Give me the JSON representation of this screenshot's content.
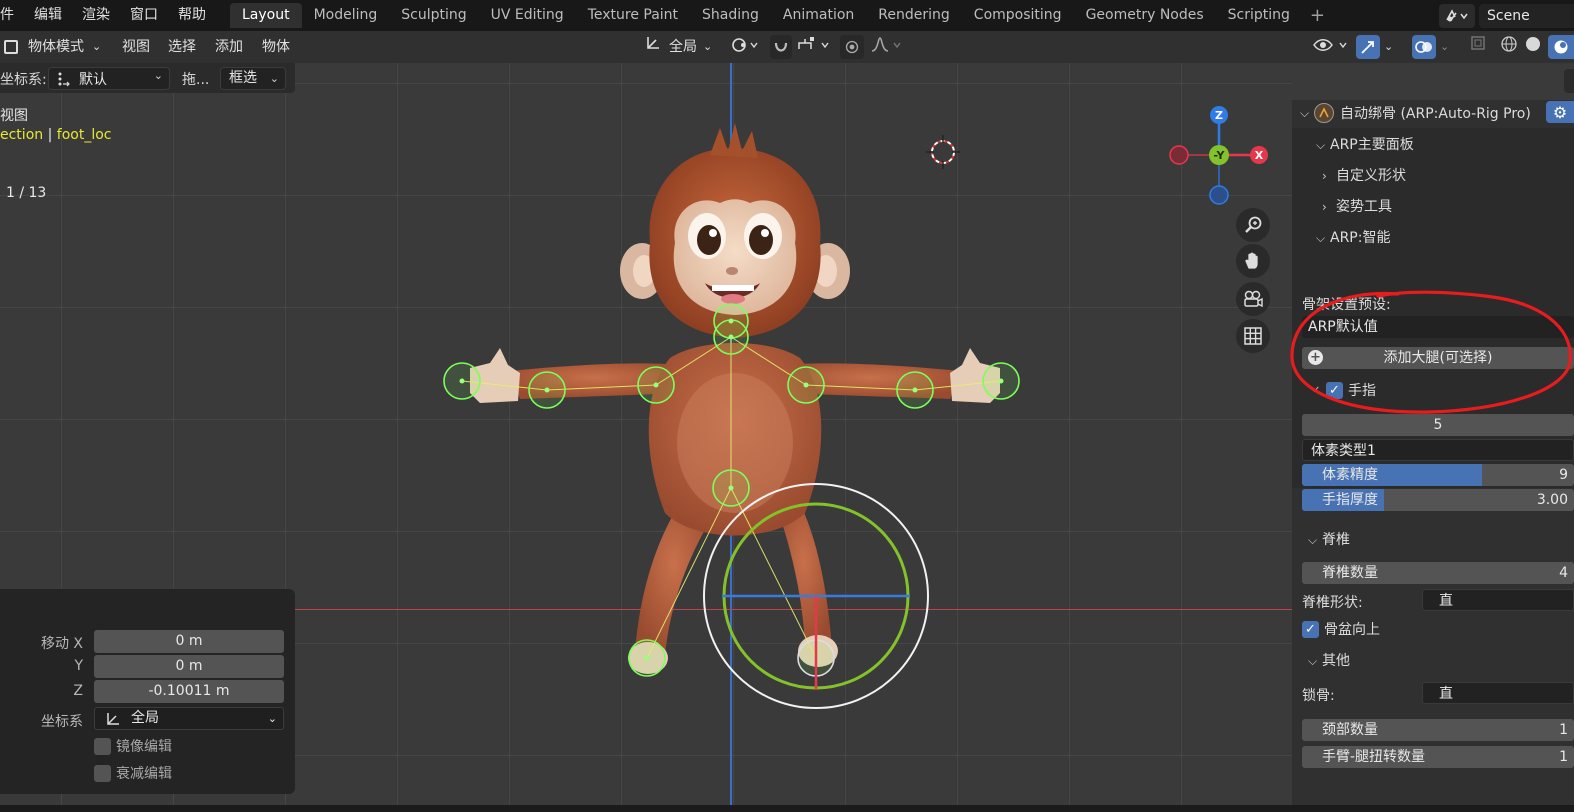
{
  "topbar": {
    "menus": [
      "件",
      "编辑",
      "渲染",
      "窗口",
      "帮助"
    ],
    "workspaces": [
      "Layout",
      "Modeling",
      "Sculpting",
      "UV Editing",
      "Texture Paint",
      "Shading",
      "Animation",
      "Rendering",
      "Compositing",
      "Geometry Nodes",
      "Scripting"
    ],
    "active_workspace": "Layout",
    "add_tab": "+",
    "scene_name": "Scene"
  },
  "header": {
    "mode": "物体模式",
    "menus": [
      "视图",
      "选择",
      "添加",
      "物体"
    ],
    "transform_orientation": "全局",
    "coord_label": "坐标系:",
    "coord_value": "默认",
    "drag_label": "拖...",
    "select_mode": "框选"
  },
  "viewport": {
    "view_name": "视图",
    "collection": "ection",
    "object_name": "foot_loc",
    "frame_count": "1 / 13",
    "gizmo": {
      "z": "Z",
      "y": "-Y",
      "x": "X"
    }
  },
  "operator_panel": {
    "move_x_label": "移动 X",
    "move_x": "0 m",
    "y_label": "Y",
    "move_y": "0 m",
    "z_label": "Z",
    "move_z": "-0.10011 m",
    "orientation_label": "坐标系",
    "orientation_value": "全局",
    "mirror_edit": "镜像编辑",
    "proportional_edit": "衰减编辑"
  },
  "sidebar": {
    "addon_title": "自动绑骨 (ARP:Auto-Rig Pro)",
    "main_panel": "ARP主要面板",
    "custom_shapes": "自定义形状",
    "pose_tools": "姿势工具",
    "smart": "ARP:智能",
    "preset_label": "骨架设置预设:",
    "preset_value": "ARP默认值",
    "add_legs": "添加大腿(可选择)",
    "fingers": "手指",
    "finger_count": "5",
    "voxel_type": "体素类型1",
    "voxel_precision_label": "体素精度",
    "voxel_precision_value": "9",
    "voxel_precision_fill": 0.66,
    "finger_thickness_label": "手指厚度",
    "finger_thickness_value": "3.00",
    "finger_thickness_fill": 0.3,
    "spine_section": "脊椎",
    "spine_count_label": "脊椎数量",
    "spine_count_value": "4",
    "spine_shape_label": "脊椎形状:",
    "spine_shape_value": "直",
    "pelvis_up": "骨盆向上",
    "other_section": "其他",
    "lock_bone_label": "锁骨:",
    "lock_bone_value": "直",
    "neck_count_label": "颈部数量",
    "neck_count_value": "1",
    "twist_label": "手臂-腿扭转数量",
    "twist_value": "1"
  },
  "colors": {
    "accent": "#4772b3",
    "annotation": "#e81c1c",
    "bone_green": "#7cff5a",
    "axis_x": "#e5384d",
    "axis_y": "#84c22b",
    "axis_z": "#2f7be8",
    "object_yellow": "#e8e835"
  }
}
